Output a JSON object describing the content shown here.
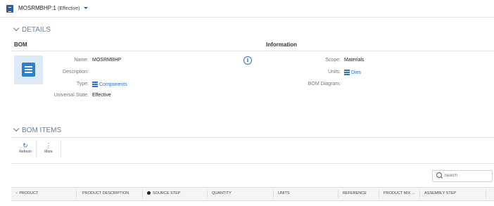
{
  "header": {
    "title": "MOSRMBHP:1",
    "state": "(Effective)"
  },
  "details": {
    "section_label": "DETAILS",
    "bom_heading": "BOM",
    "information_heading": "Information",
    "fields": {
      "name_label": "Name:",
      "name_value": "MOSRMBHP",
      "description_label": "Description:",
      "type_label": "Type:",
      "type_value": "Components",
      "universal_state_label": "Universal State:",
      "universal_state_value": "Effective"
    },
    "info_fields": {
      "scope_label": "Scope:",
      "scope_value": "Materials",
      "units_label": "Units:",
      "units_value": "Dies",
      "diagram_label": "BOM Diagram:"
    }
  },
  "bom_items": {
    "section_label": "BOM ITEMS",
    "toolbar": {
      "refresh_label": "Refresh",
      "more_label": "More"
    },
    "search_placeholder": "Search",
    "columns": [
      "PRODUCT",
      "PRODUCT DESCRIPTION",
      "SOURCE STEP",
      "QUANTITY",
      "UNITS",
      "REFERENCE",
      "PRODUCT MIX ...",
      "ASSEMBLY STEP"
    ]
  },
  "colors": {
    "accent": "#2c6fbe",
    "brand": "#2c5ea8",
    "section_heading": "#6a7d93",
    "thumb_bg": "#dde9f5"
  },
  "icons": [
    "bom-document-icon",
    "chevron-down-icon",
    "list-icon",
    "info-icon",
    "refresh-icon",
    "more-vertical-icon",
    "search-icon",
    "product-tree-icon",
    "circle-icon"
  ]
}
